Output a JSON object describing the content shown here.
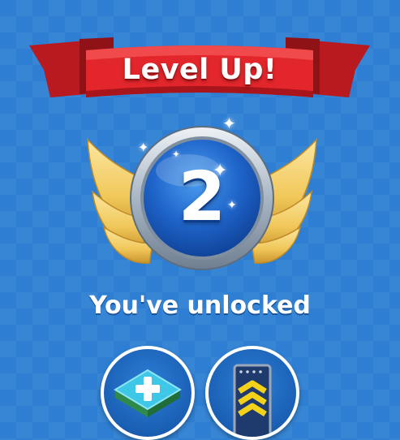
{
  "banner": {
    "title": "Level Up!"
  },
  "level": {
    "number": "2"
  },
  "unlocked": {
    "heading": "You've unlocked",
    "items": [
      {
        "icon": "tile-plus-icon"
      },
      {
        "icon": "rank-chevrons-icon"
      }
    ]
  },
  "colors": {
    "background": "#2e7fd3",
    "ribbon_red": "#e3262b",
    "wing_gold": "#f1c75a",
    "orb_blue": "#1e63c8",
    "badge_silver": "#c9d2dc"
  }
}
